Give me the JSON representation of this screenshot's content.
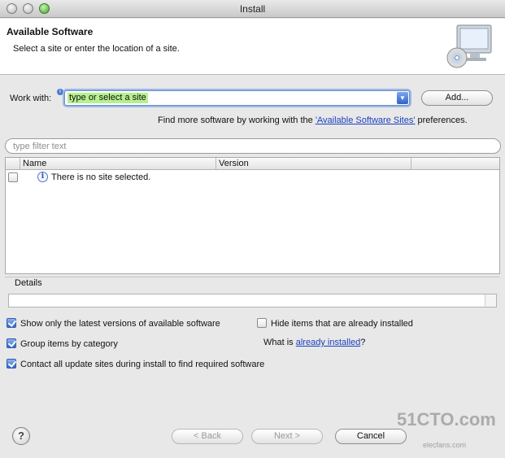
{
  "window": {
    "title": "Install"
  },
  "header": {
    "title": "Available Software",
    "description": "Select a site or enter the location of a site."
  },
  "work_with": {
    "label": "Work with:",
    "value": "type or select a site",
    "add_button": "Add..."
  },
  "find_more": {
    "prefix": "Find more software by working with the",
    "link": "'Available Software Sites'",
    "suffix": "preferences."
  },
  "filter": {
    "placeholder": "type filter text"
  },
  "table": {
    "columns": [
      "Name",
      "Version"
    ],
    "rows": [
      {
        "checked": false,
        "name": "There is no site selected.",
        "version": ""
      }
    ]
  },
  "details": {
    "label": "Details"
  },
  "options": {
    "show_latest": {
      "label": "Show only the latest versions of available software",
      "checked": true
    },
    "hide_installed": {
      "label": "Hide items that are already installed",
      "checked": false
    },
    "group_by_category": {
      "label": "Group items by category",
      "checked": true
    },
    "what_is_prefix": "What is",
    "what_is_link": "already installed",
    "what_is_suffix": "?",
    "contact_sites": {
      "label": "Contact all update sites during install to find required software",
      "checked": true
    }
  },
  "footer": {
    "help": "?",
    "back": "< Back",
    "next": "Next >",
    "cancel": "Cancel"
  },
  "watermark": {
    "brand": "51CTO.com",
    "sub": "elecfans.com"
  },
  "colors": {
    "accent": "#2f68cf",
    "combo_highlight": "#b7f08f",
    "link": "#1a3fbf"
  }
}
